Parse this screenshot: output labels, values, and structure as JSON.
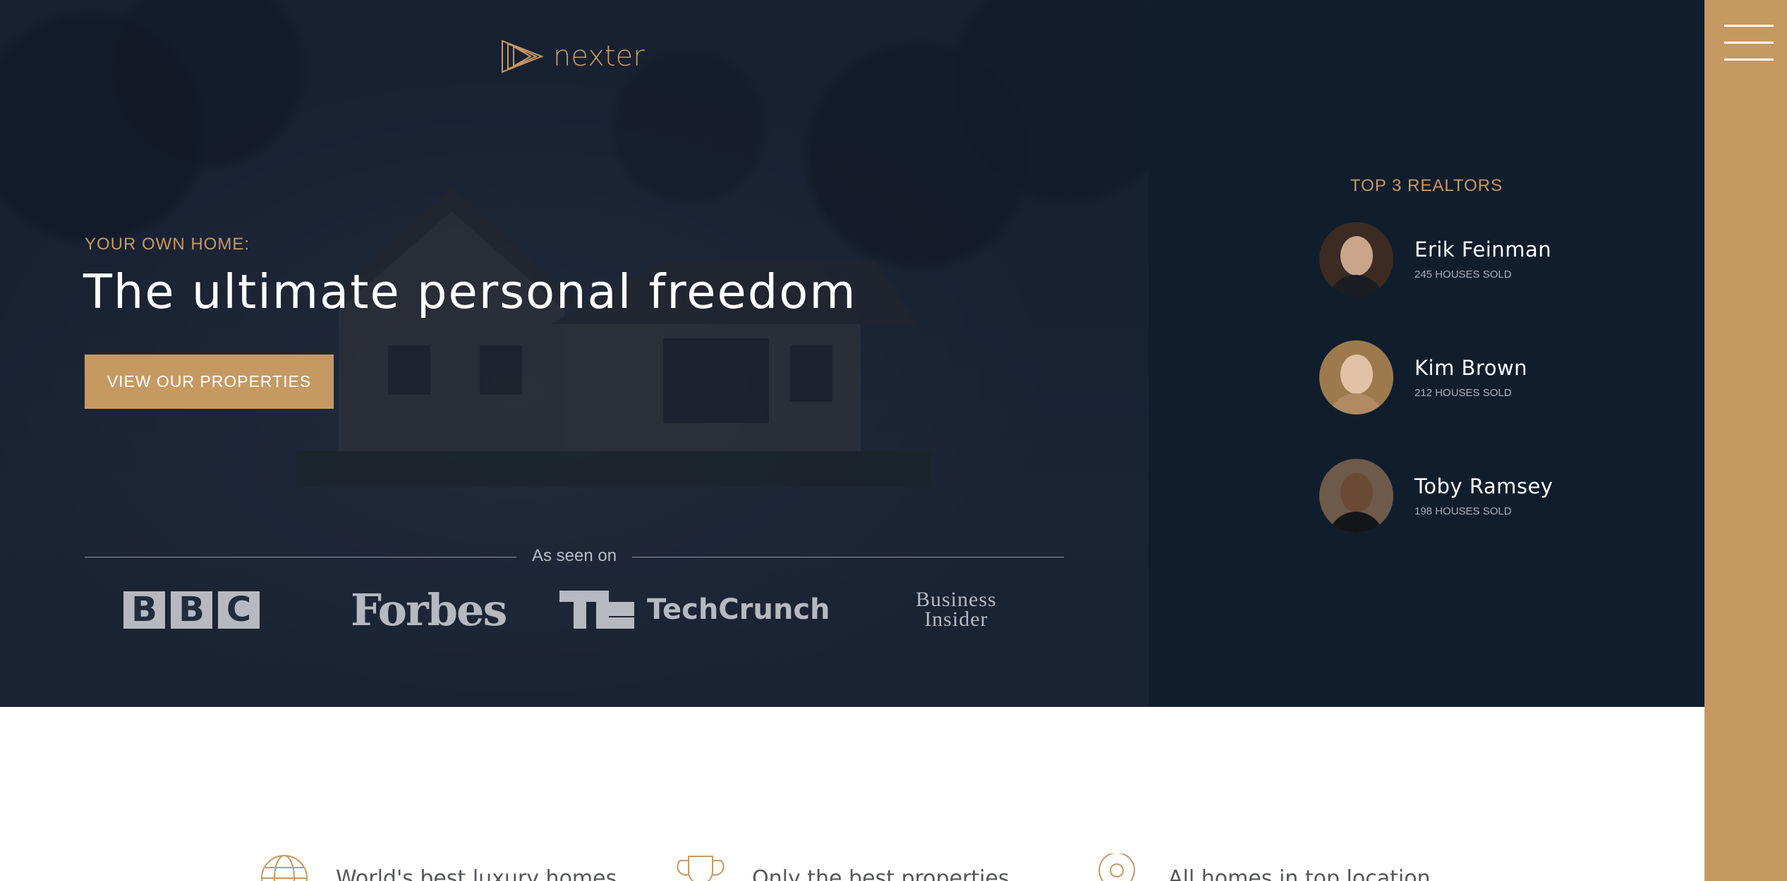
{
  "brand": {
    "name": "nexter",
    "accent": "#c69963"
  },
  "hero": {
    "kicker": "YOUR OWN HOME:",
    "headline": "The ultimate personal freedom",
    "cta_label": "VIEW OUR PROPERTIES",
    "seen_on_label": "As seen on",
    "press": {
      "bbc": [
        "B",
        "B",
        "C"
      ],
      "forbes": "Forbes",
      "techcrunch": "TechCrunch",
      "business_insider_line1": "Business",
      "business_insider_line2": "Insider"
    }
  },
  "realtors": {
    "title": "TOP 3 REALTORS",
    "items": [
      {
        "name": "Erik Feinman",
        "sold": "245 HOUSES SOLD"
      },
      {
        "name": "Kim Brown",
        "sold": "212 HOUSES SOLD"
      },
      {
        "name": "Toby Ramsey",
        "sold": "198 HOUSES SOLD"
      }
    ]
  },
  "sidebar": {
    "menu_icon": "hamburger-menu-icon"
  },
  "features": [
    {
      "icon": "globe-icon",
      "label": "World's best luxury homes"
    },
    {
      "icon": "trophy-icon",
      "label": "Only the best properties"
    },
    {
      "icon": "map-pin-icon",
      "label": "All homes in top location"
    }
  ]
}
